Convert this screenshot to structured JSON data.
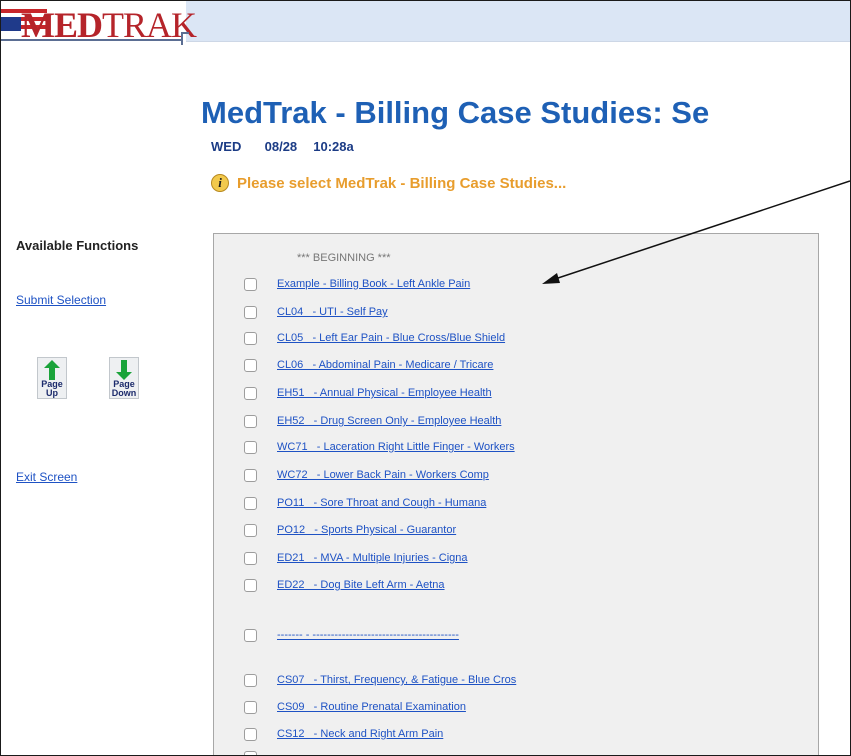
{
  "logo": {
    "text_a": "MED",
    "text_b": "TRAK"
  },
  "page": {
    "title": "MedTrak - Billing Case Studies: Se",
    "day": "WED",
    "date": "08/28",
    "time": "10:28a",
    "notice": "Please select MedTrak - Billing Case Studies..."
  },
  "sidebar": {
    "heading": "Available Functions",
    "submit": "Submit Selection",
    "page_up": [
      "Page",
      "Up"
    ],
    "page_down": [
      "Page",
      "Down"
    ],
    "exit": "Exit Screen"
  },
  "list": {
    "beginning": "*** BEGINNING ***",
    "items": [
      "Example - Billing Book - Left Ankle Pain",
      "CL04   - UTI - Self Pay",
      "CL05   - Left Ear Pain - Blue Cross/Blue Shield",
      "CL06   - Abdominal Pain - Medicare / Tricare",
      "EH51   - Annual Physical - Employee Health",
      "EH52   - Drug Screen Only - Employee Health",
      "WC71   - Laceration Right Little Finger - Workers",
      "WC72   - Lower Back Pain - Workers Comp",
      "PO11   - Sore Throat and Cough - Humana",
      "PO12   - Sports Physical - Guarantor",
      "ED21   - MVA - Multiple Injuries - Cigna",
      "ED22   - Dog Bite Left Arm - Aetna",
      "------- - ----------------------------------------",
      "CS07   - Thirst, Frequency, & Fatigue - Blue Cros",
      "CS09   - Routine Prenatal Examination",
      "CS12   - Neck and Right Arm Pain"
    ]
  },
  "colors": {
    "title": "#1e60b5",
    "notice": "#e89d2d",
    "link": "#1e52c4",
    "header_bar": "#dbe6f5",
    "arrow_green": "#1aa33a"
  }
}
